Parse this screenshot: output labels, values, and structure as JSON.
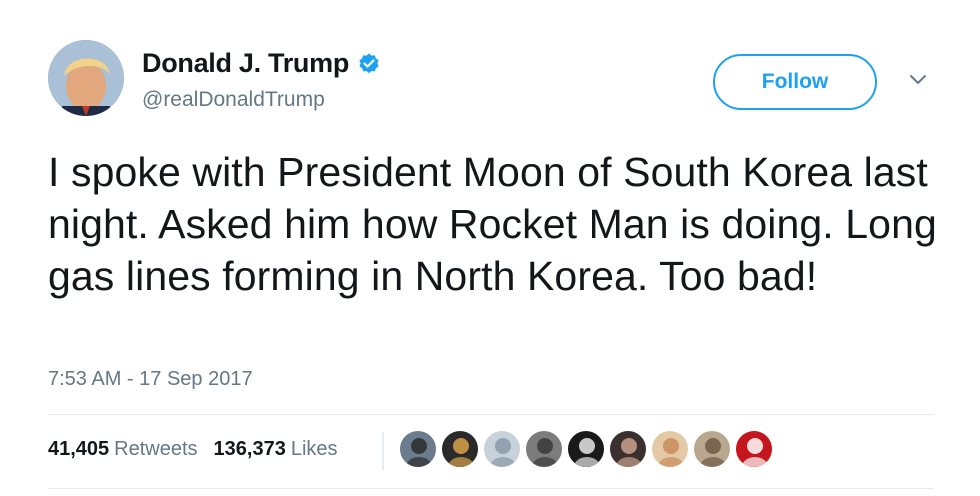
{
  "author": {
    "display_name": "Donald J. Trump",
    "handle": "@realDonaldTrump",
    "verified": true,
    "avatar_icon": "profile-photo",
    "verified_icon": "verified-badge-icon"
  },
  "actions": {
    "follow_label": "Follow",
    "more_icon": "chevron-down-icon"
  },
  "tweet": {
    "text": "I spoke with President Moon of South Korea last night. Asked him how Rocket Man is doing. Long gas lines forming in North Korea. Too bad!",
    "timestamp": "7:53 AM - 17 Sep 2017"
  },
  "stats": {
    "retweets_count": "41,405",
    "retweets_label": "Retweets",
    "likes_count": "136,373",
    "likes_label": "Likes"
  },
  "likers": [
    {
      "name": "liker-avatar-1",
      "bg": "#6b7d8c",
      "fg": "#2b2b2b"
    },
    {
      "name": "liker-avatar-2",
      "bg": "#2a2a2a",
      "fg": "#d8a24a"
    },
    {
      "name": "liker-avatar-3",
      "bg": "#c7d1da",
      "fg": "#8a9aa8"
    },
    {
      "name": "liker-avatar-4",
      "bg": "#7c7c7c",
      "fg": "#3a3a3a"
    },
    {
      "name": "liker-avatar-5",
      "bg": "#1a1a1a",
      "fg": "#e8e8e8"
    },
    {
      "name": "liker-avatar-6",
      "bg": "#3b3030",
      "fg": "#c9a28c"
    },
    {
      "name": "liker-avatar-7",
      "bg": "#e3c9a6",
      "fg": "#c98b5a"
    },
    {
      "name": "liker-avatar-8",
      "bg": "#b9a78f",
      "fg": "#6e5a44"
    },
    {
      "name": "liker-avatar-9",
      "bg": "#c4161c",
      "fg": "#ffffff"
    }
  ],
  "colors": {
    "accent": "#1da1f2",
    "secondary_text": "#657786",
    "primary_text": "#14171a"
  }
}
